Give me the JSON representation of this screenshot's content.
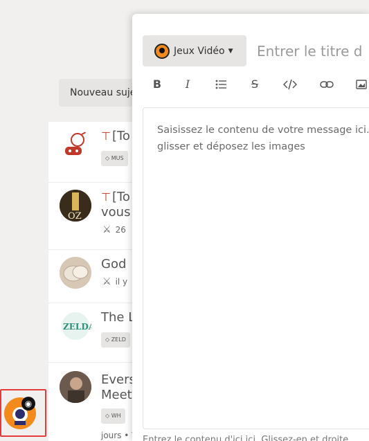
{
  "forum": {
    "new_topic_label": "Nouveau sujet",
    "topics": [
      {
        "title": "[To",
        "pinned": true,
        "tag": "MUS"
      },
      {
        "title_line1": "[To",
        "title_line2": "vous",
        "pinned": true,
        "meta": "26"
      },
      {
        "title": "God",
        "meta": "il y"
      },
      {
        "title": "The L",
        "tag": "ZELD"
      },
      {
        "title_line1": "Evers",
        "title_line2": "Meet",
        "tag": "WH",
        "meta": "jours • V"
      }
    ]
  },
  "composer": {
    "category_label": "Jeux Vidéo",
    "title_placeholder": "Entrer le titre d",
    "toolbar": [
      "bold-icon",
      "italic-icon",
      "bulleted-list-icon",
      "strikethrough-icon",
      "code-icon",
      "link-icon",
      "image-icon"
    ],
    "editor_placeholder": "Saisissez le contenu de votre message ici. glisser et déposez les images",
    "footer_hint": "Entrez le contenu d'ici ici. Glissez-en et droite"
  },
  "colors": {
    "accent_orange": "#f28a1c",
    "pin_red": "#c0392b",
    "widget_border": "#e53b3b"
  }
}
